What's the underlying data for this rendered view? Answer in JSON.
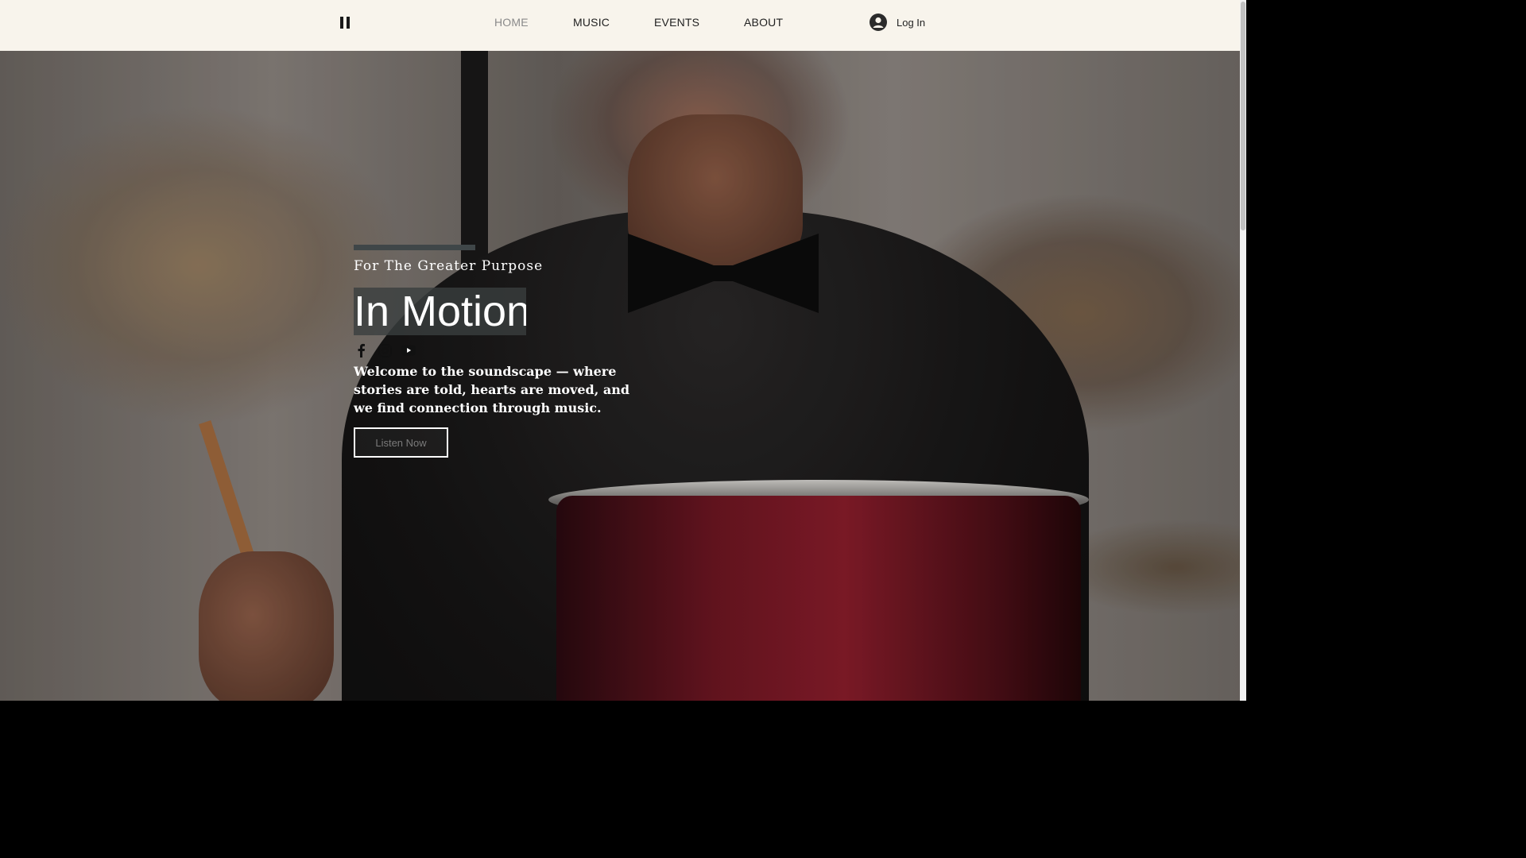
{
  "header": {
    "nav": [
      {
        "label": "HOME",
        "active": true
      },
      {
        "label": "MUSIC",
        "active": false
      },
      {
        "label": "EVENTS",
        "active": false
      },
      {
        "label": "ABOUT",
        "active": false
      }
    ],
    "login_label": "Log In",
    "pause_icon": "pause-icon",
    "login_icon": "user-avatar-icon"
  },
  "hero": {
    "tagline": "For The Greater Purpose",
    "title": "In Motion",
    "socials": [
      "facebook-icon",
      "instagram-icon",
      "youtube-icon"
    ],
    "welcome_text": "Welcome to the soundscape — where stories are told, hearts are moved, and we find connection through music.",
    "cta_label": "Listen Now"
  },
  "colors": {
    "header_bg": "#f8f4ec",
    "accent_bar": "#3f4648",
    "title_bg": "#3a3e3e"
  }
}
